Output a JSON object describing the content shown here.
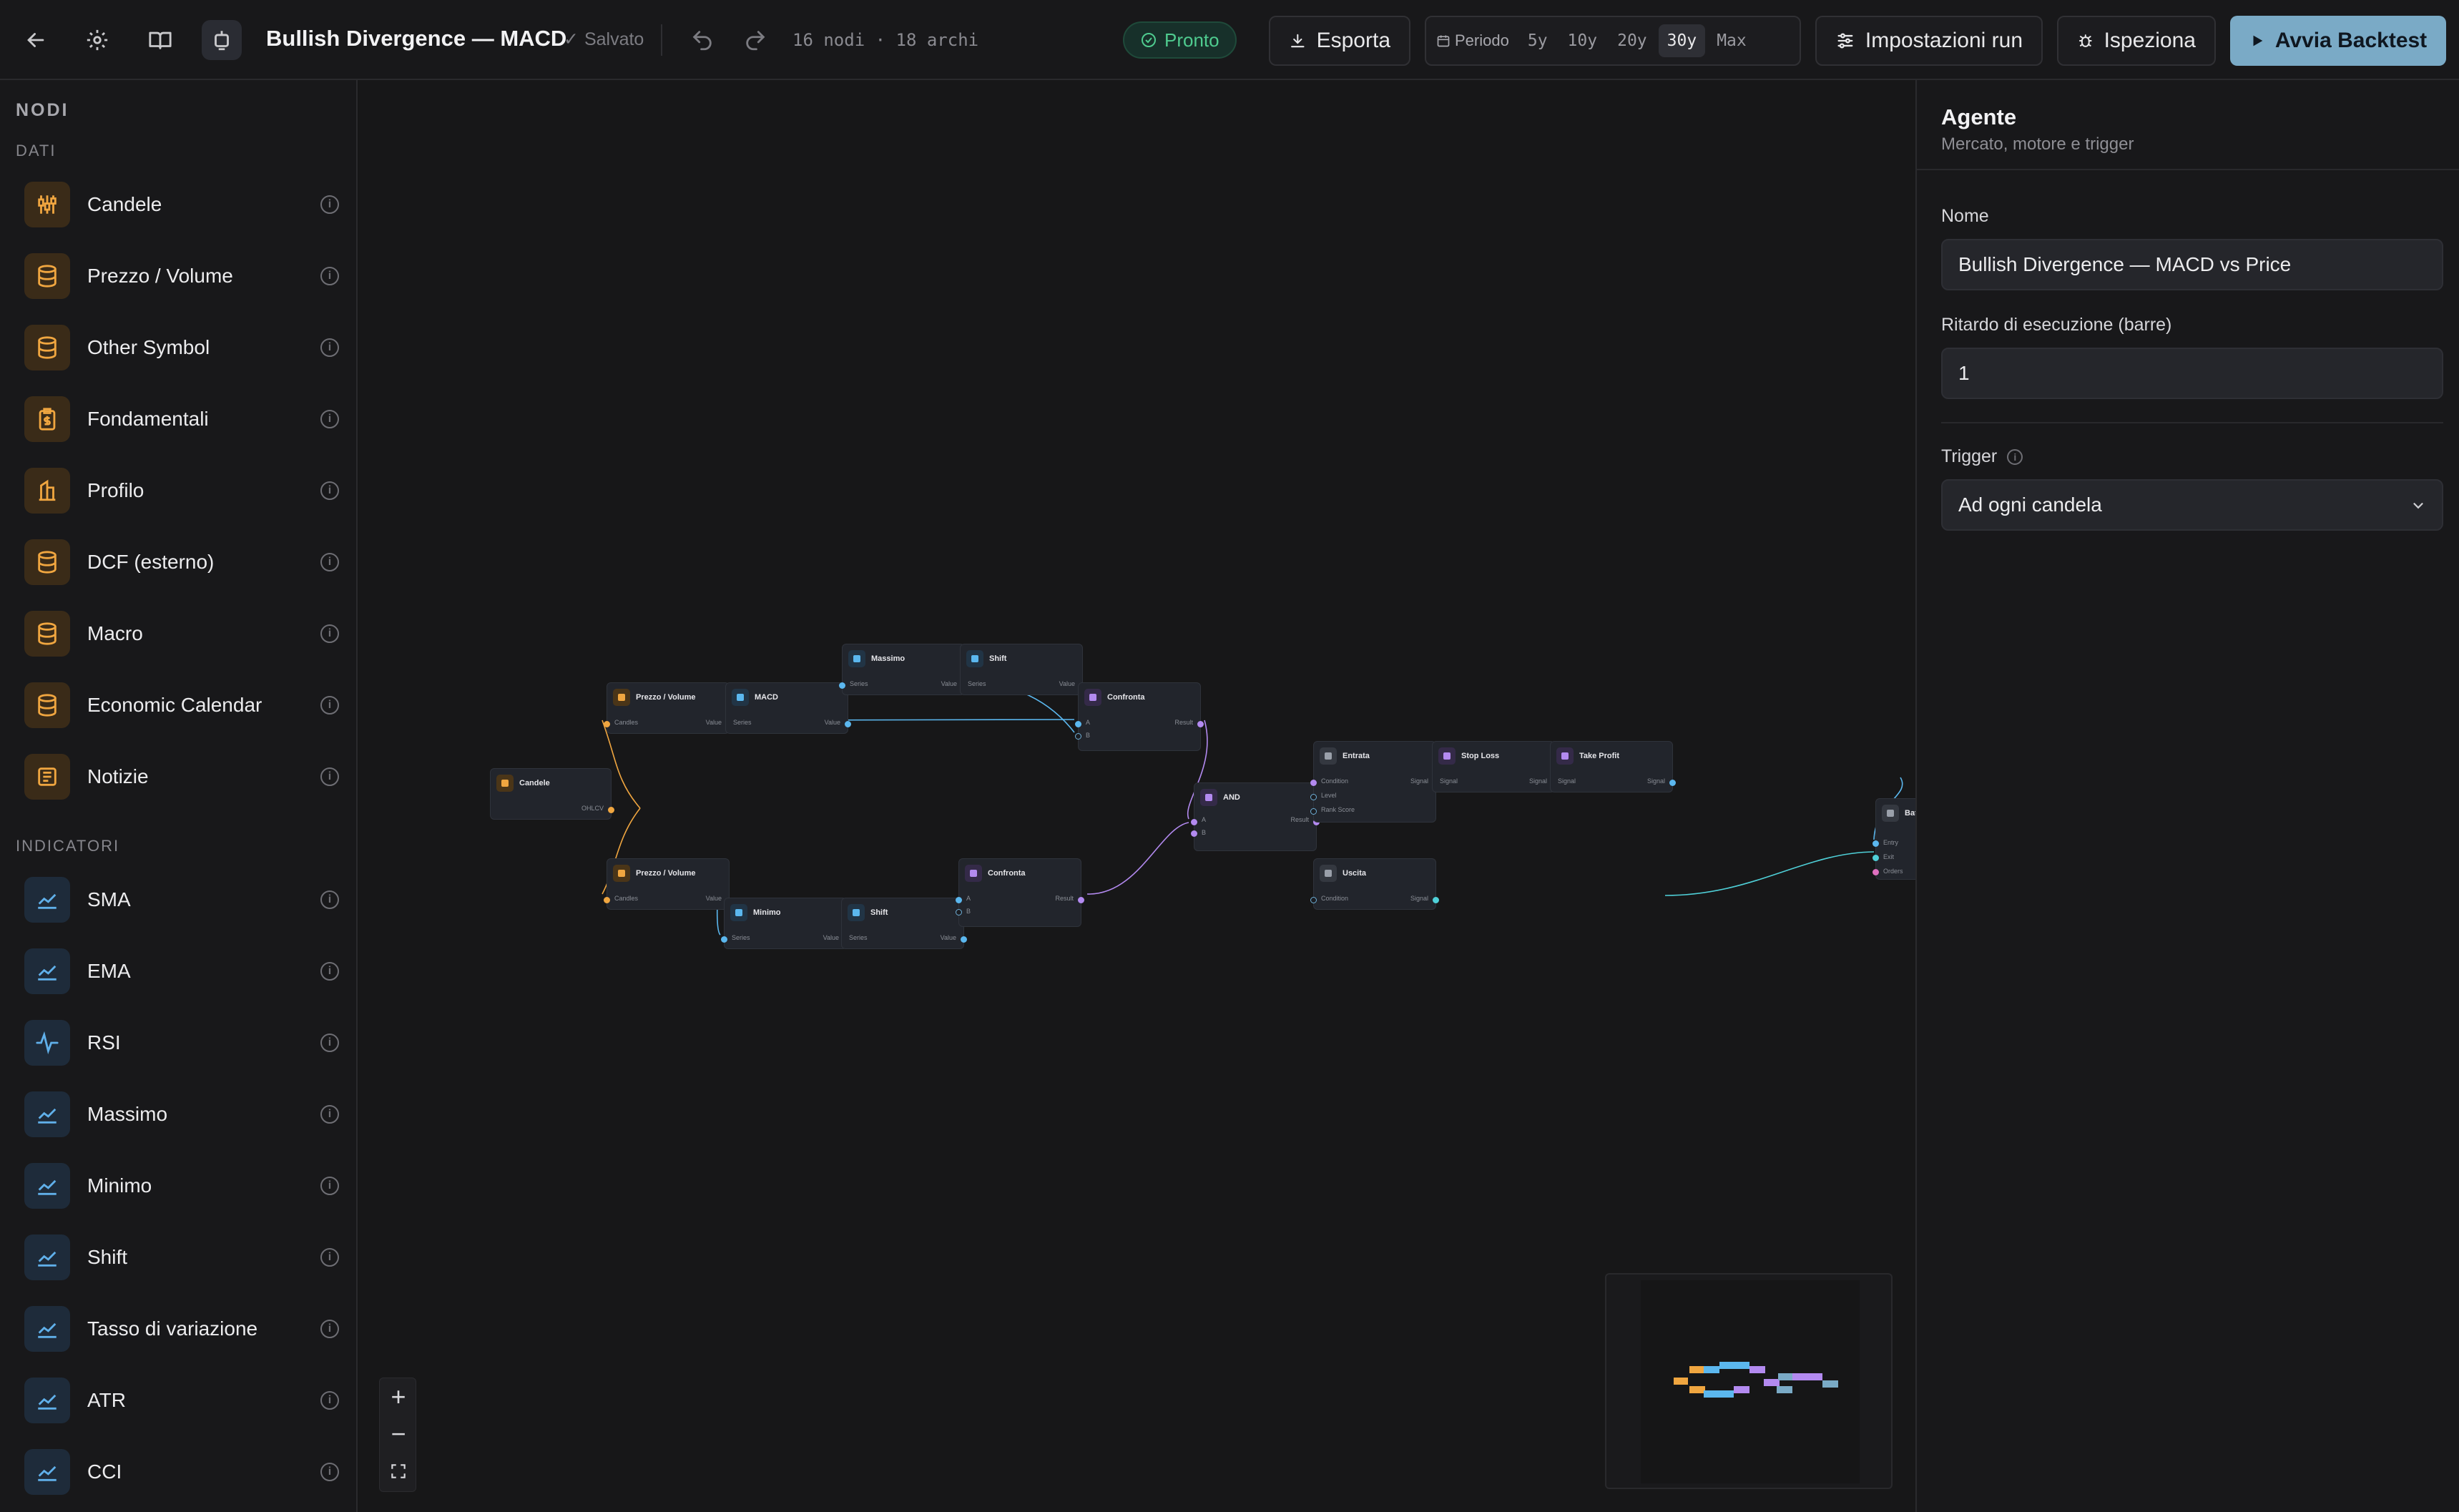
{
  "topbar": {
    "title": "Bullish Divergence — MACD",
    "saved": "Salvato",
    "stats": "16 nodi · 18 archi",
    "status": "Pronto",
    "export_label": "Esporta",
    "period_label": "Periodo",
    "periods": [
      "5y",
      "10y",
      "20y",
      "30y",
      "Max"
    ],
    "active_period": "30y",
    "run_settings_label": "Impostazioni run",
    "inspect_label": "Ispeziona",
    "run_label": "Avvia Backtest"
  },
  "sidebar": {
    "heading": "NODI",
    "groups": [
      {
        "label": "DATI",
        "items": [
          "Candele",
          "Prezzo / Volume",
          "Other Symbol",
          "Fondamentali",
          "Profilo",
          "DCF (esterno)",
          "Macro",
          "Economic Calendar",
          "Notizie"
        ]
      },
      {
        "label": "INDICATORI",
        "items": [
          "SMA",
          "EMA",
          "RSI",
          "Massimo",
          "Minimo",
          "Shift",
          "Tasso di variazione",
          "ATR",
          "CCI"
        ]
      }
    ]
  },
  "canvas": {
    "nodes": {
      "candele": {
        "title": "Candele",
        "pins": [
          "OHLCV"
        ]
      },
      "pv_top": {
        "title": "Prezzo / Volume",
        "pins": [
          "Candles",
          "Value"
        ]
      },
      "macd": {
        "title": "MACD",
        "pins": [
          "Series",
          "Value"
        ]
      },
      "massimo": {
        "title": "Massimo",
        "pins": [
          "Series",
          "Value"
        ]
      },
      "shift_top": {
        "title": "Shift",
        "pins": [
          "Series",
          "Value"
        ]
      },
      "confronta_top": {
        "title": "Confronta",
        "pins": [
          "A",
          "B",
          "Result"
        ]
      },
      "pv_bottom": {
        "title": "Prezzo / Volume",
        "pins": [
          "Candles",
          "Value"
        ]
      },
      "minimo": {
        "title": "Minimo",
        "pins": [
          "Series",
          "Value"
        ]
      },
      "shift_bottom": {
        "title": "Shift",
        "pins": [
          "Series",
          "Value"
        ]
      },
      "confronta_bottom": {
        "title": "Confronta",
        "pins": [
          "A",
          "B",
          "Result"
        ]
      },
      "and": {
        "title": "AND",
        "pins": [
          "A",
          "B",
          "Result"
        ]
      },
      "entrata": {
        "title": "Entrata",
        "pins": [
          "Condition",
          "Level",
          "Rank Score",
          "Signal"
        ]
      },
      "stop_loss": {
        "title": "Stop Loss",
        "pins": [
          "Signal",
          "Signal"
        ]
      },
      "take_profit": {
        "title": "Take Profit",
        "pins": [
          "Signal",
          "Signal"
        ]
      },
      "uscita": {
        "title": "Uscita",
        "pins": [
          "Condition",
          "Signal"
        ]
      },
      "batch": {
        "title": "Batch ordini",
        "pins": [
          "Entry",
          "Exit",
          "Orders"
        ]
      }
    }
  },
  "inspector": {
    "title": "Agente",
    "subtitle": "Mercato, motore e trigger",
    "name_label": "Nome",
    "name_value": "Bullish Divergence — MACD vs Price",
    "delay_label": "Ritardo di esecuzione (barre)",
    "delay_value": "1",
    "trigger_label": "Trigger",
    "trigger_value": "Ad ogni candela"
  },
  "colors": {
    "accent": "#7aaac6",
    "data_icon": "#f0a640",
    "indicator_icon": "#60b0ea",
    "logic": "#b38af0",
    "ready": "#4fcb8f"
  }
}
